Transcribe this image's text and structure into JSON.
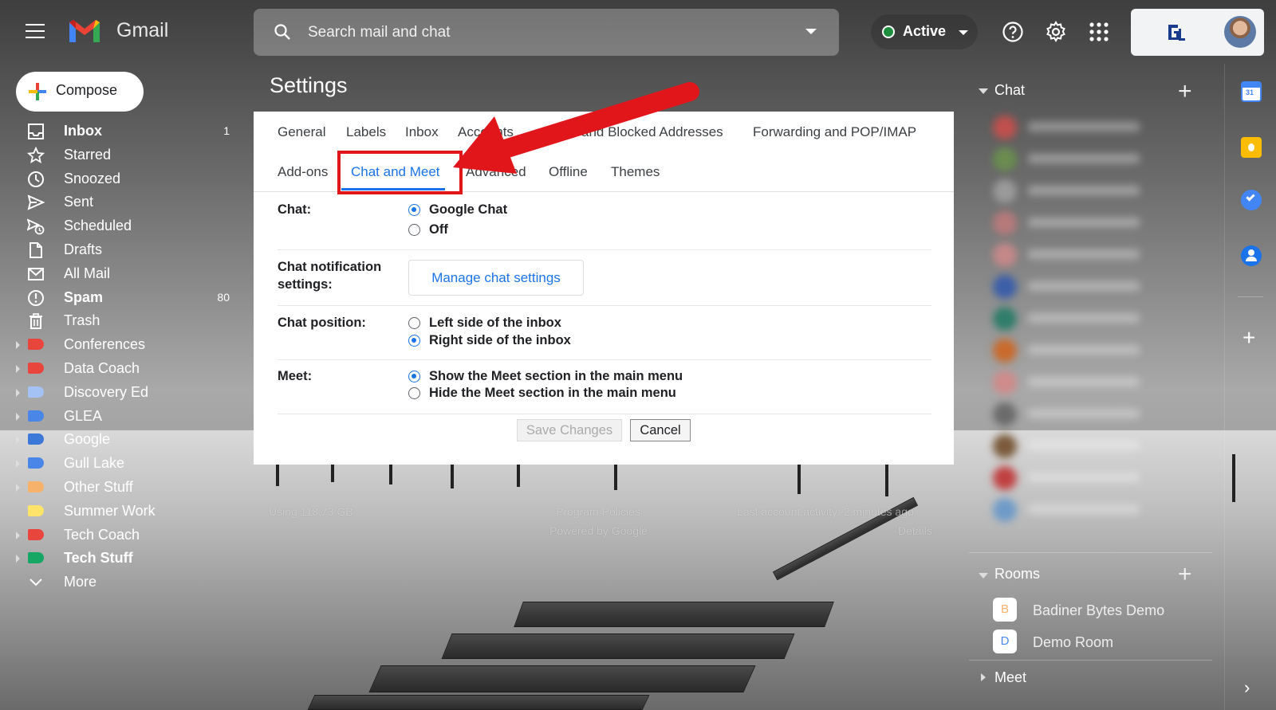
{
  "app": {
    "name": "Gmail"
  },
  "search": {
    "placeholder": "Search mail and chat"
  },
  "status": {
    "label": "Active",
    "color": "#1e8e3e"
  },
  "compose": {
    "label": "Compose"
  },
  "nav": {
    "items": [
      {
        "label": "Inbox",
        "count": "1",
        "bold": true,
        "icon": "inbox-icon"
      },
      {
        "label": "Starred",
        "count": "",
        "icon": "star-icon"
      },
      {
        "label": "Snoozed",
        "count": "",
        "icon": "clock-icon"
      },
      {
        "label": "Sent",
        "count": "",
        "icon": "send-icon"
      },
      {
        "label": "Scheduled",
        "count": "",
        "icon": "scheduled-icon"
      },
      {
        "label": "Drafts",
        "count": "",
        "icon": "draft-icon"
      },
      {
        "label": "All Mail",
        "count": "",
        "icon": "mail-icon"
      },
      {
        "label": "Spam",
        "count": "80",
        "bold": true,
        "icon": "spam-icon"
      },
      {
        "label": "Trash",
        "count": "",
        "icon": "trash-icon"
      }
    ],
    "labels": [
      {
        "label": "Conferences",
        "color": "#e8453c",
        "expandable": true
      },
      {
        "label": "Data Coach",
        "color": "#e8453c",
        "expandable": true
      },
      {
        "label": "Discovery Ed",
        "color": "#a4c2f4",
        "expandable": true
      },
      {
        "label": "GLEA",
        "color": "#4a86e8",
        "expandable": true
      },
      {
        "label": "Google",
        "color": "#3c78d8",
        "expandable": true
      },
      {
        "label": "Gull Lake",
        "color": "#4a86e8",
        "expandable": true
      },
      {
        "label": "Other Stuff",
        "color": "#f6b26b",
        "expandable": true
      },
      {
        "label": "Summer Work",
        "color": "#ffe36b",
        "expandable": false
      },
      {
        "label": "Tech Coach",
        "color": "#e8453c",
        "expandable": true
      },
      {
        "label": "Tech Stuff",
        "color": "#16a765",
        "expandable": true,
        "bold": true
      }
    ],
    "more": "More"
  },
  "settings": {
    "title": "Settings",
    "tabs_row1": [
      "General",
      "Labels",
      "Inbox",
      "Accounts",
      "and Blocked Addresses",
      "Forwarding and POP/IMAP"
    ],
    "tabs_row2": [
      "Add-ons",
      "Chat and Meet",
      "Advanced",
      "Offline",
      "Themes"
    ],
    "selected_tab": "Chat and Meet",
    "chat": {
      "label": "Chat:",
      "options": [
        "Google Chat",
        "Off"
      ],
      "selected": "Google Chat"
    },
    "notification": {
      "label_line1": "Chat notification",
      "label_line2": "settings:",
      "button": "Manage chat settings"
    },
    "position": {
      "label": "Chat position:",
      "options": [
        "Left side of the inbox",
        "Right side of the inbox"
      ],
      "selected": "Right side of the inbox"
    },
    "meet": {
      "label": "Meet:",
      "options": [
        "Show the Meet section in the main menu",
        "Hide the Meet section in the main menu"
      ],
      "selected": "Show the Meet section in the main menu"
    },
    "save_label": "Save Changes",
    "cancel_label": "Cancel"
  },
  "footer": {
    "storage": "Using 118.73 GB",
    "policies": "Program Policies",
    "powered": "Powered by Google",
    "activity": "Last account activity: 2 minutes ago",
    "details": "Details"
  },
  "chat": {
    "title": "Chat",
    "rooms_title": "Rooms",
    "rooms": [
      {
        "initial": "B",
        "name": "Badiner Bytes Demo",
        "color": "#f6b26b"
      },
      {
        "initial": "D",
        "name": "Demo Room",
        "color": "#4a86e8"
      }
    ],
    "meet_title": "Meet"
  },
  "addons": [
    "calendar-icon",
    "keep-icon",
    "tasks-icon",
    "contacts-icon"
  ],
  "annotation": {
    "color": "#e0161b"
  }
}
